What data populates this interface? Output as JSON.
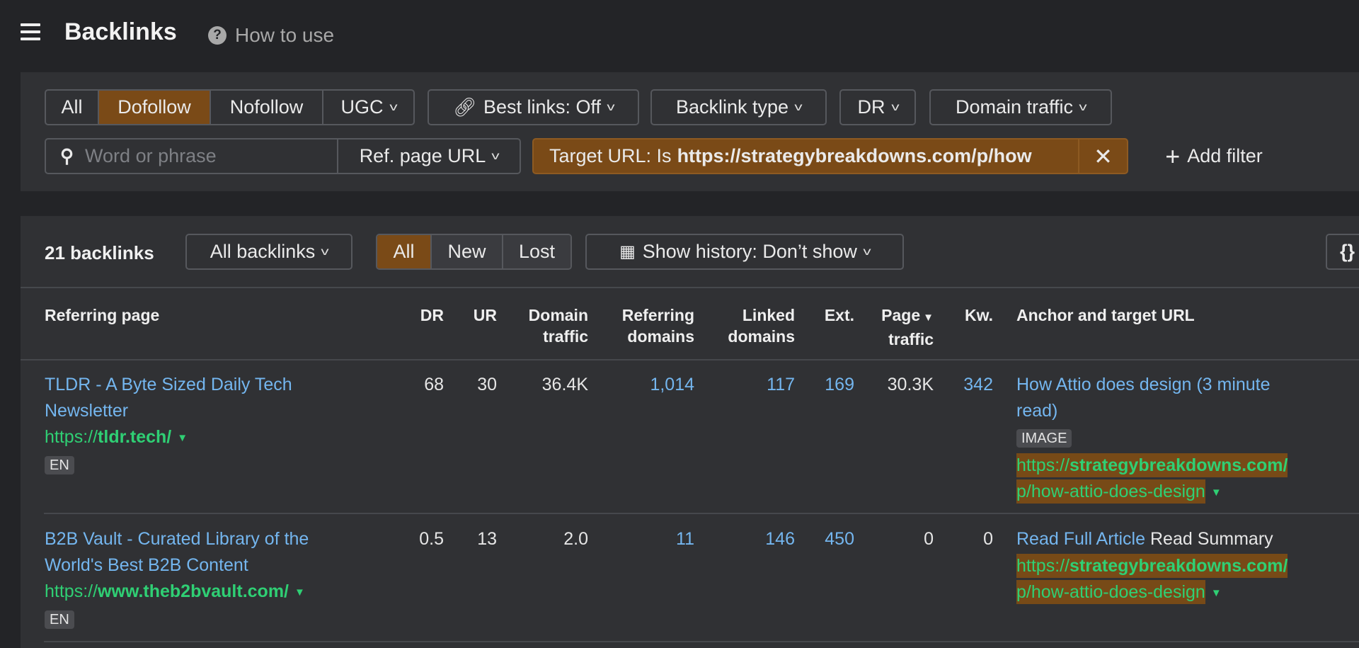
{
  "header": {
    "title": "Backlinks",
    "help": "How to use"
  },
  "filters": {
    "link_type": [
      "All",
      "Dofollow",
      "Nofollow",
      "UGC"
    ],
    "best_links": "Best links: Off",
    "backlink_type": "Backlink type",
    "dr": "DR",
    "domain_traffic": "Domain traffic",
    "search_placeholder": "Word or phrase",
    "search_scope": "Ref. page URL",
    "active_filter_prefix": "Target URL: Is",
    "active_filter_value": "https://strategybreakdowns.com/p/how",
    "add_filter": "Add filter"
  },
  "toolbar": {
    "count": "21 backlinks",
    "view": "All backlinks",
    "status_tabs": [
      "All",
      "New",
      "Lost"
    ],
    "history": "Show history: Don’t show",
    "export_icon": "{}"
  },
  "columns": [
    "Referring page",
    "DR",
    "UR",
    "Domain traffic",
    "Referring domains",
    "Linked domains",
    "Ext.",
    "Page traffic",
    "Kw.",
    "Anchor and target URL"
  ],
  "columns_split": {
    "dt1": "Domain",
    "dt2": "traffic",
    "rd1": "Referring",
    "rd2": "domains",
    "ld1": "Linked",
    "ld2": "domains",
    "pt1": "Page",
    "pt2": "traffic"
  },
  "rows": [
    {
      "title1": "TLDR - A Byte Sized Daily Tech",
      "title2": "Newsletter",
      "url_prefix": "https://",
      "url_domain": "tldr.tech/",
      "lang": "EN",
      "dr": "68",
      "ur": "30",
      "domain_traffic": "36.4K",
      "ref_domains": "1,014",
      "linked_domains": "117",
      "ext": "169",
      "page_traffic": "30.3K",
      "kw": "342",
      "anchor1": "How Attio does design (3 minute",
      "anchor2": "read)",
      "anchor_extra": "",
      "badge": "IMAGE",
      "target_prefix": "https://",
      "target_domain": "strategybreakdowns.com/",
      "target_path": "p/how-attio-does-design"
    },
    {
      "title1": "B2B Vault - Curated Library of the",
      "title2": "World's Best B2B Content",
      "url_prefix": "https://",
      "url_domain": "www.theb2bvault.com/",
      "lang": "EN",
      "dr": "0.5",
      "ur": "13",
      "domain_traffic": "2.0",
      "ref_domains": "11",
      "linked_domains": "146",
      "ext": "450",
      "page_traffic": "0",
      "kw": "0",
      "anchor1": "Read Full Article",
      "anchor2": "",
      "anchor_extra": "Read Summary",
      "badge": "",
      "target_prefix": "https://",
      "target_domain": "strategybreakdowns.com/",
      "target_path": "p/how-attio-does-design"
    }
  ]
}
